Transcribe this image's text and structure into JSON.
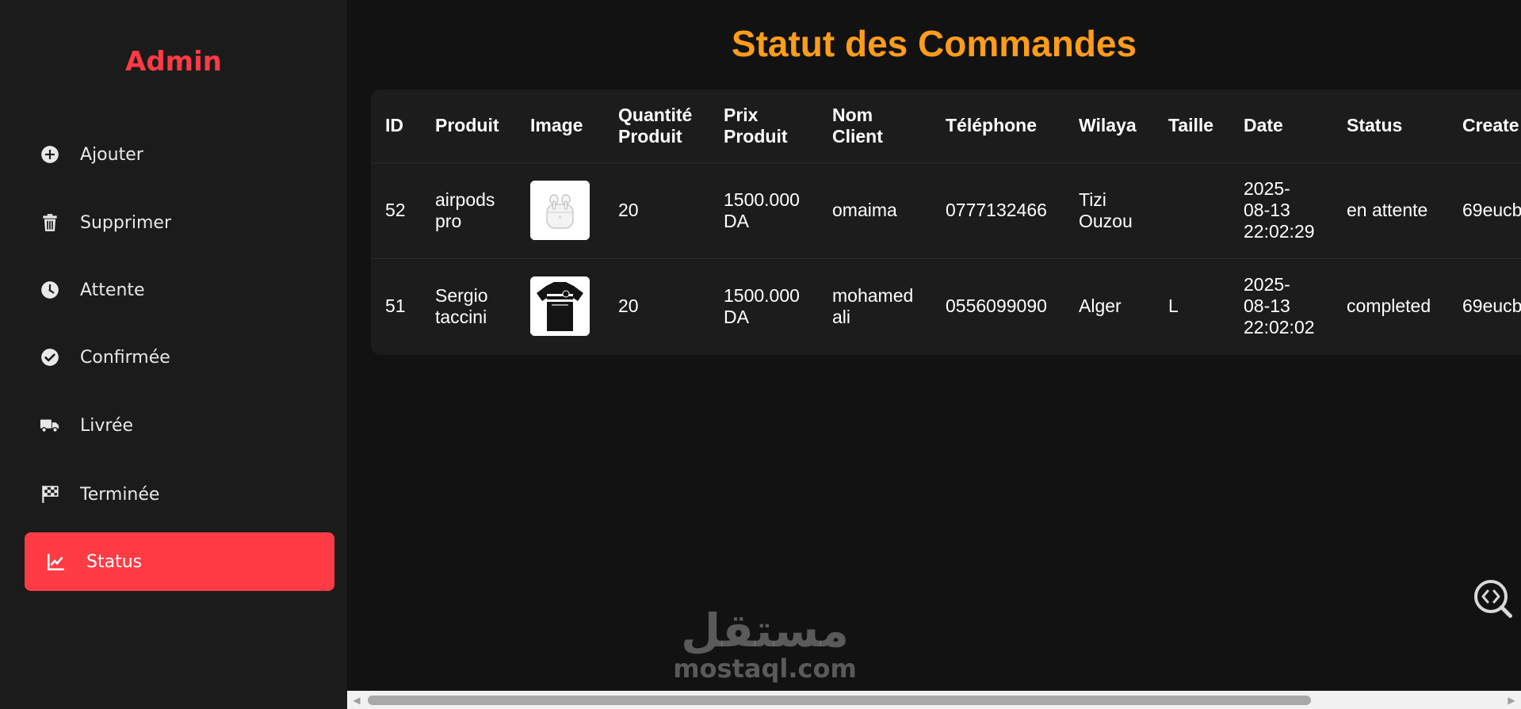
{
  "sidebar": {
    "brand": "Admin",
    "items": [
      {
        "label": "Ajouter",
        "icon": "plus-circle-icon"
      },
      {
        "label": "Supprimer",
        "icon": "trash-icon"
      },
      {
        "label": "Attente",
        "icon": "clock-icon"
      },
      {
        "label": "Confirmée",
        "icon": "check-circle-icon"
      },
      {
        "label": "Livrée",
        "icon": "truck-icon"
      },
      {
        "label": "Terminée",
        "icon": "checkered-flag-icon"
      },
      {
        "label": "Status",
        "icon": "chart-line-icon",
        "active": true
      }
    ]
  },
  "main": {
    "title": "Statut des Commandes",
    "table": {
      "headers": {
        "id": "ID",
        "produit": "Produit",
        "image": "Image",
        "quantite_l1": "Quantité",
        "quantite_l2": "Produit",
        "prix_l1": "Prix",
        "prix_l2": "Produit",
        "nom_l1": "Nom",
        "nom_l2": "Client",
        "telephone": "Téléphone",
        "wilaya": "Wilaya",
        "taille": "Taille",
        "date": "Date",
        "status": "Status",
        "created": "Create"
      },
      "rows": [
        {
          "id": "52",
          "produit_l1": "airpods",
          "produit_l2": "pro",
          "image": "airpods-image",
          "quantite": "20",
          "prix_l1": "1500.000",
          "prix_l2": "DA",
          "nom_l1": "omaima",
          "nom_l2": "",
          "telephone": "0777132466",
          "wilaya_l1": "Tizi",
          "wilaya_l2": "Ouzou",
          "taille": "",
          "date_l1": "2025-",
          "date_l2": "08-13",
          "date_l3": "22:02:29",
          "status": "en attente",
          "created": "69eucb"
        },
        {
          "id": "51",
          "produit_l1": "Sergio",
          "produit_l2": "taccini",
          "image": "tshirt-image",
          "quantite": "20",
          "prix_l1": "1500.000",
          "prix_l2": "DA",
          "nom_l1": "mohamed",
          "nom_l2": "ali",
          "telephone": "0556099090",
          "wilaya_l1": "Alger",
          "wilaya_l2": "",
          "taille": "L",
          "date_l1": "2025-",
          "date_l2": "08-13",
          "date_l3": "22:02:02",
          "status": "completed",
          "created": "69eucb"
        }
      ]
    }
  },
  "watermark": {
    "arabic": "مستقل",
    "latin": "mostaql.com"
  },
  "colors": {
    "accent_red": "#ff3b45",
    "title_orange": "#ff9d1a",
    "sidebar_bg": "#1b1b1b",
    "main_bg": "#121212",
    "table_bg": "#1c1c1c"
  }
}
